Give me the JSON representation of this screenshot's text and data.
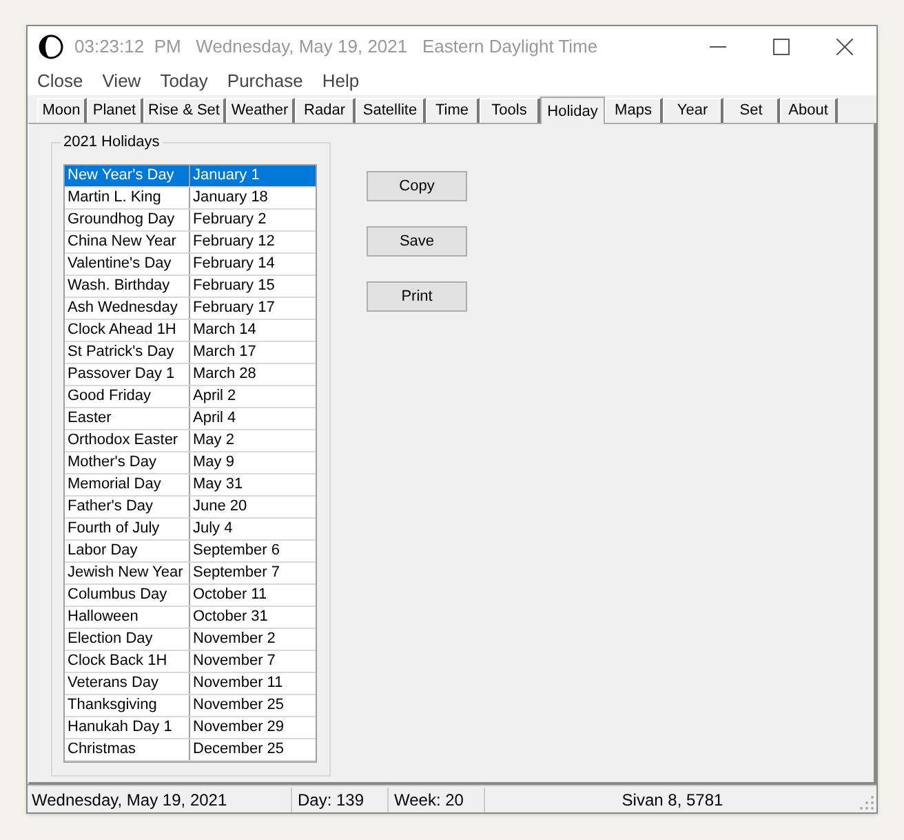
{
  "window": {
    "title": "03:23:12  PM   Wednesday, May 19, 2021   Eastern Daylight Time"
  },
  "menu": [
    "Close",
    "View",
    "Today",
    "Purchase",
    "Help"
  ],
  "tabs": [
    {
      "label": "Moon",
      "selected": false
    },
    {
      "label": "Planet",
      "selected": false
    },
    {
      "label": "Rise & Set",
      "selected": false
    },
    {
      "label": "Weather",
      "selected": false
    },
    {
      "label": "Radar",
      "selected": false
    },
    {
      "label": "Satellite",
      "selected": false
    },
    {
      "label": "Time",
      "selected": false
    },
    {
      "label": "Tools",
      "selected": false
    },
    {
      "label": "Holiday",
      "selected": true
    },
    {
      "label": "Maps",
      "selected": false
    },
    {
      "label": "Year",
      "selected": false
    },
    {
      "label": "Set",
      "selected": false
    },
    {
      "label": "About",
      "selected": false
    }
  ],
  "group": {
    "title": "2021 Holidays",
    "rows": [
      {
        "name": "New Year's Day",
        "date": "January 1",
        "selected": true
      },
      {
        "name": "Martin L. King",
        "date": "January 18",
        "selected": false
      },
      {
        "name": "Groundhog Day",
        "date": "February 2",
        "selected": false
      },
      {
        "name": "China New Year",
        "date": "February 12",
        "selected": false
      },
      {
        "name": "Valentine's Day",
        "date": "February 14",
        "selected": false
      },
      {
        "name": "Wash. Birthday",
        "date": "February 15",
        "selected": false
      },
      {
        "name": "Ash Wednesday",
        "date": "February 17",
        "selected": false
      },
      {
        "name": "Clock Ahead 1H",
        "date": "March 14",
        "selected": false
      },
      {
        "name": "St Patrick's Day",
        "date": "March 17",
        "selected": false
      },
      {
        "name": "Passover Day 1",
        "date": "March 28",
        "selected": false
      },
      {
        "name": "Good Friday",
        "date": "April 2",
        "selected": false
      },
      {
        "name": "Easter",
        "date": "April 4",
        "selected": false
      },
      {
        "name": "Orthodox Easter",
        "date": "May 2",
        "selected": false
      },
      {
        "name": "Mother's Day",
        "date": "May 9",
        "selected": false
      },
      {
        "name": "Memorial Day",
        "date": "May 31",
        "selected": false
      },
      {
        "name": "Father's Day",
        "date": "June 20",
        "selected": false
      },
      {
        "name": "Fourth of July",
        "date": "July 4",
        "selected": false
      },
      {
        "name": "Labor Day",
        "date": "September 6",
        "selected": false
      },
      {
        "name": "Jewish New Year",
        "date": "September 7",
        "selected": false
      },
      {
        "name": "Columbus Day",
        "date": "October 11",
        "selected": false
      },
      {
        "name": "Halloween",
        "date": "October 31",
        "selected": false
      },
      {
        "name": "Election Day",
        "date": "November 2",
        "selected": false
      },
      {
        "name": "Clock Back 1H",
        "date": "November 7",
        "selected": false
      },
      {
        "name": "Veterans Day",
        "date": "November 11",
        "selected": false
      },
      {
        "name": "Thanksgiving",
        "date": "November 25",
        "selected": false
      },
      {
        "name": "Hanukah Day 1",
        "date": "November 29",
        "selected": false
      },
      {
        "name": "Christmas",
        "date": "December 25",
        "selected": false
      }
    ]
  },
  "buttons": [
    "Copy",
    "Save",
    "Print"
  ],
  "status_bar": [
    "Wednesday, May 19, 2021",
    "Day: 139",
    "Week: 20",
    "Sivan 8, 5781"
  ]
}
